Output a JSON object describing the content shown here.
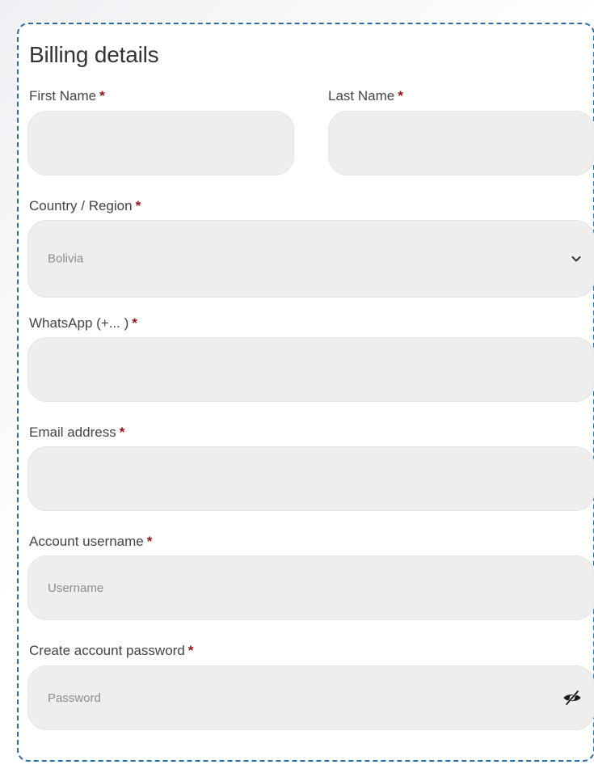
{
  "form": {
    "title": "Billing details",
    "required_mark": "*",
    "fields": {
      "first_name": {
        "label": "First Name",
        "value": "",
        "placeholder": ""
      },
      "last_name": {
        "label": "Last Name",
        "value": "",
        "placeholder": ""
      },
      "country": {
        "label": "Country / Region",
        "selected": "Bolivia"
      },
      "whatsapp": {
        "label": "WhatsApp (+... )",
        "value": "",
        "placeholder": ""
      },
      "email": {
        "label": "Email address",
        "value": "",
        "placeholder": ""
      },
      "username": {
        "label": "Account username",
        "value": "",
        "placeholder": "Username"
      },
      "password": {
        "label": "Create account password",
        "value": "",
        "placeholder": "Password"
      }
    }
  },
  "icons": {
    "country_dropdown": "chevron-down-icon",
    "password_toggle": "eye-slash-icon"
  },
  "colors": {
    "border": "#2b6ca3",
    "required": "#a0121a",
    "field_bg": "#eeeeee"
  }
}
